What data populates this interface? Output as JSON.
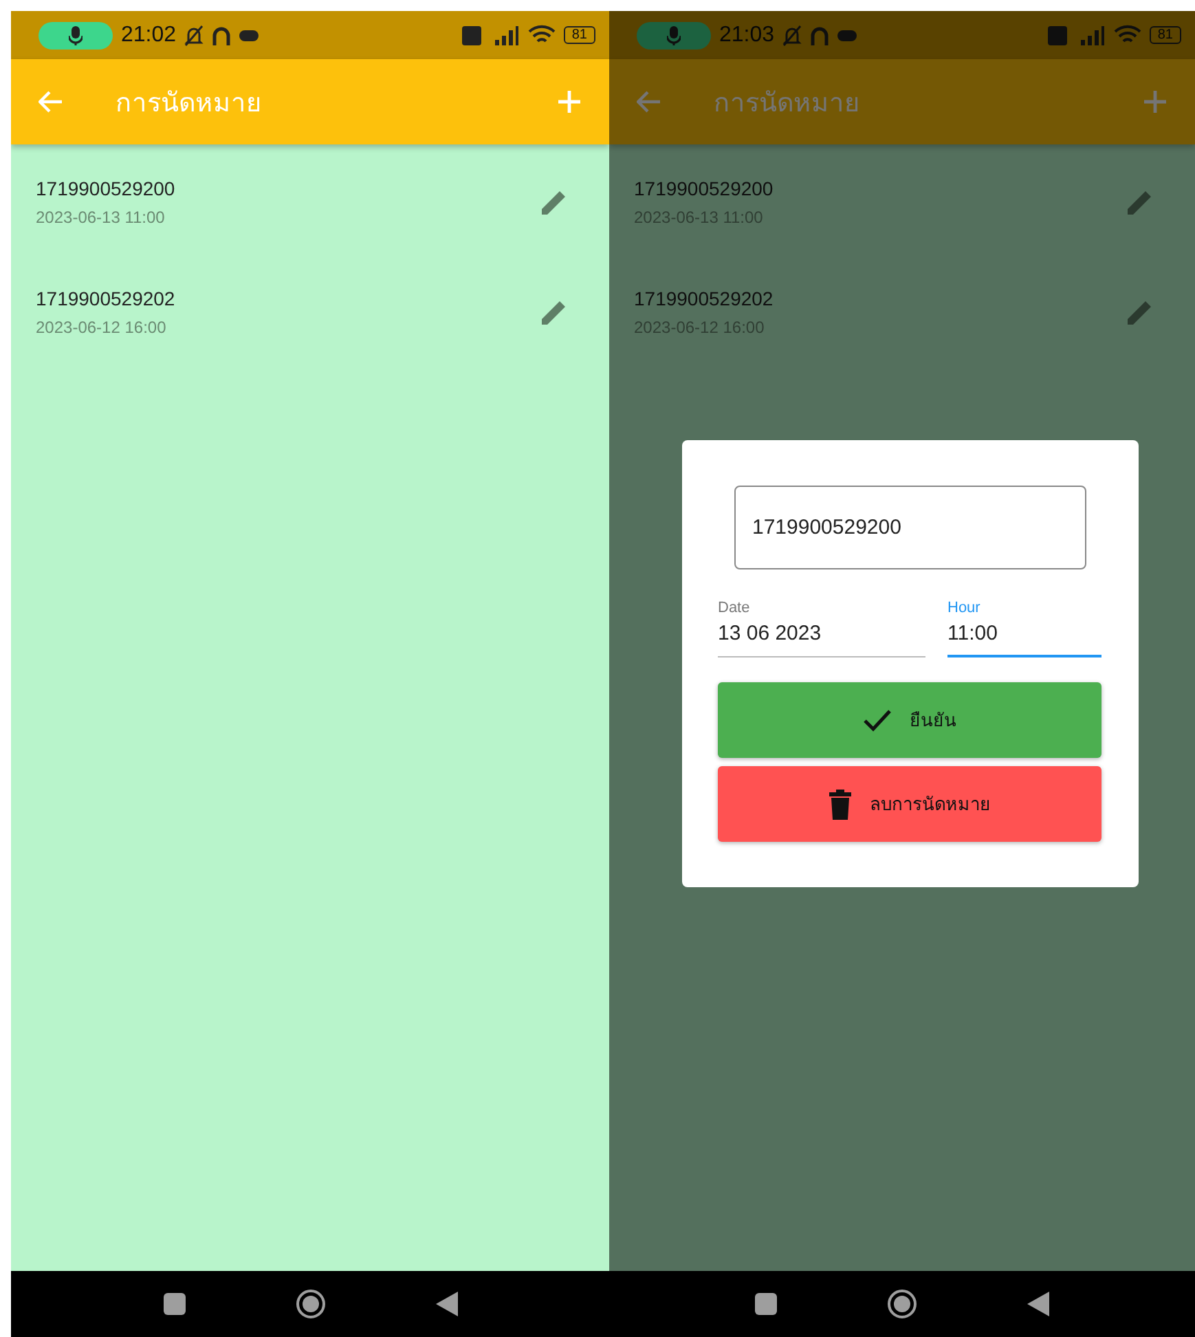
{
  "screens": [
    {
      "status_bar": {
        "time": "21:02",
        "battery": "81"
      },
      "app_bar": {
        "title": "การนัดหมาย"
      },
      "appointments": [
        {
          "id": "1719900529200",
          "datetime": "2023-06-13 11:00"
        },
        {
          "id": "1719900529202",
          "datetime": "2023-06-12 16:00"
        }
      ]
    },
    {
      "status_bar": {
        "time": "21:03",
        "battery": "81"
      },
      "app_bar": {
        "title": "การนัดหมาย"
      },
      "appointments": [
        {
          "id": "1719900529200",
          "datetime": "2023-06-13 11:00"
        },
        {
          "id": "1719900529202",
          "datetime": "2023-06-12 16:00"
        }
      ],
      "dialog": {
        "id_field": {
          "value": "1719900529200"
        },
        "date_field": {
          "label": "Date",
          "value": "13 06 2023",
          "focused": false
        },
        "hour_field": {
          "label": "Hour",
          "value": "11:00",
          "focused": true
        },
        "buttons": [
          {
            "kind": "confirm",
            "label": "ยืนยัน"
          },
          {
            "kind": "delete",
            "label": "ลบการนัดหมาย"
          }
        ]
      }
    }
  ]
}
